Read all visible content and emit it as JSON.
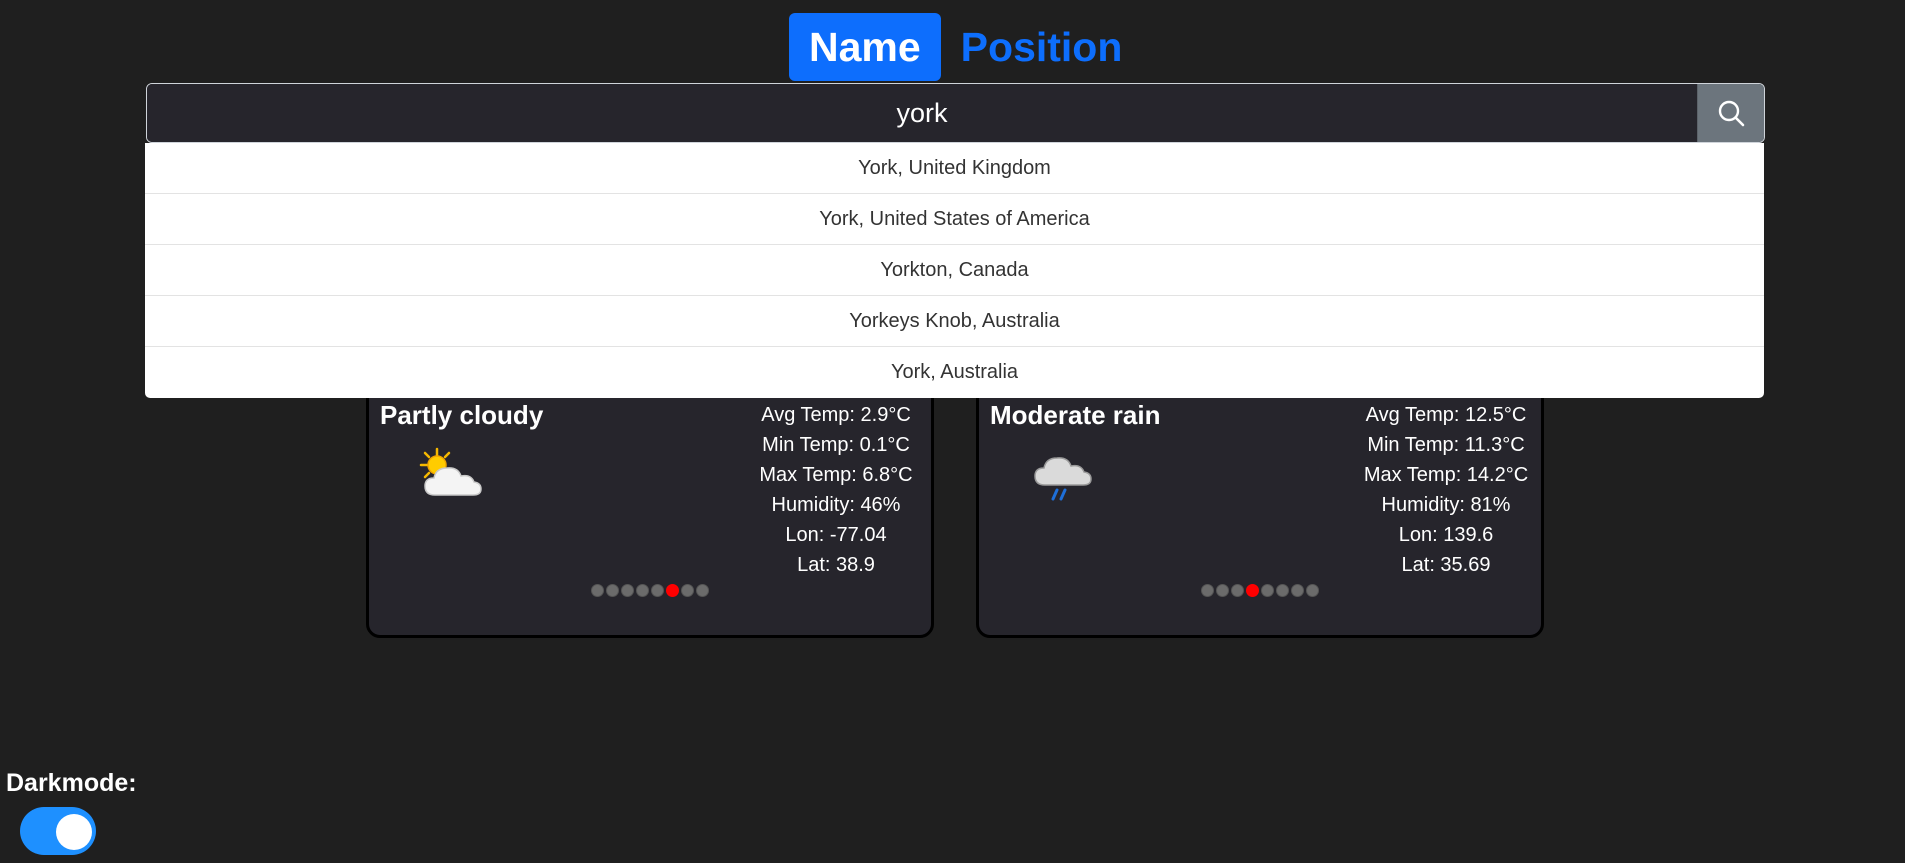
{
  "tabs": [
    {
      "label": "Name",
      "active": true
    },
    {
      "label": "Position",
      "active": false
    }
  ],
  "search": {
    "value": "york",
    "icon": "search-icon"
  },
  "suggestions": [
    "York, United Kingdom",
    "York, United States of America",
    "Yorkton, Canada",
    "Yorkeys Knob, Australia",
    "York, Australia"
  ],
  "cards": [
    {
      "condition": "Partly cloudy",
      "icon": "partly-cloudy-icon",
      "avg_temp": "Avg Temp: 2.9°C",
      "min_temp": "Min Temp: 0.1°C",
      "max_temp": "Max Temp: 6.8°C",
      "humidity": "Humidity: 46%",
      "lon": "Lon: -77.04",
      "lat": "Lat: 38.9",
      "dots_total": 8,
      "dots_active": 6
    },
    {
      "condition": "Moderate rain",
      "icon": "rain-cloud-icon",
      "avg_temp": "Avg Temp: 12.5°C",
      "min_temp": "Min Temp: 11.3°C",
      "max_temp": "Max Temp: 14.2°C",
      "humidity": "Humidity: 81%",
      "lon": "Lon: 139.6",
      "lat": "Lat: 35.69",
      "dots_total": 8,
      "dots_active": 4
    }
  ],
  "darkmode": {
    "label": "Darkmode:",
    "enabled": true
  },
  "colors": {
    "accent": "#0d6efd",
    "background": "#1f1f1f",
    "card": "#26252c",
    "active_dot": "#ff0000",
    "toggle": "#1e90ff"
  }
}
